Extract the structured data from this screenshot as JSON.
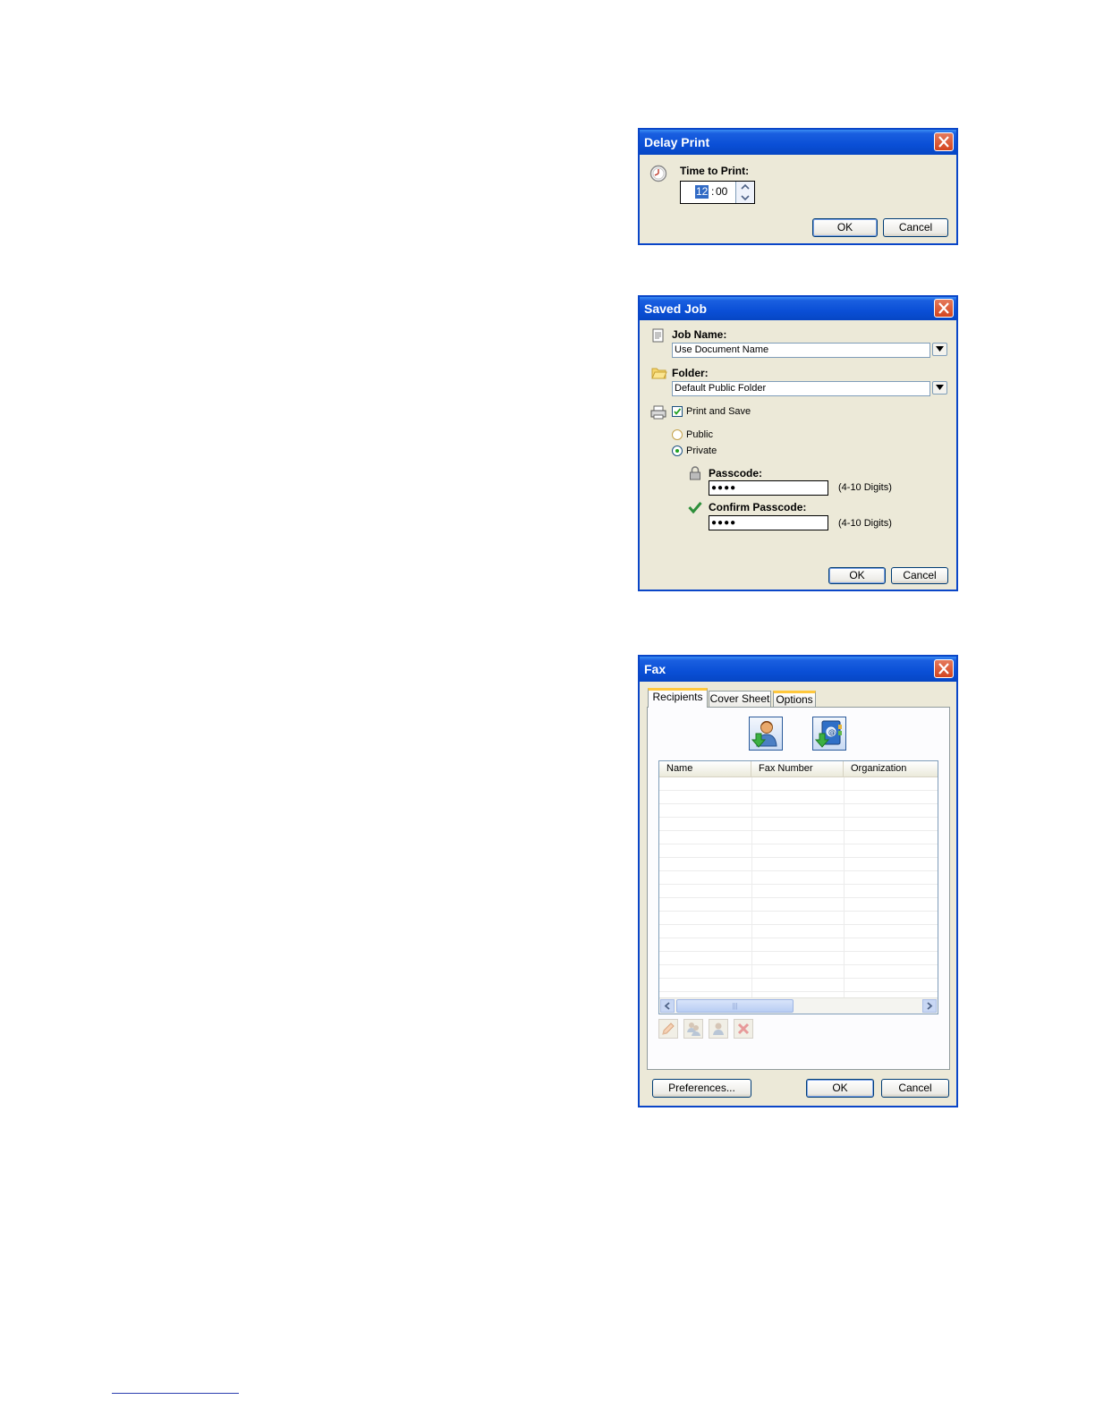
{
  "delay_print": {
    "title": "Delay Print",
    "time_label": "Time to Print:",
    "hour": "12",
    "separator": ":",
    "minute": "00",
    "ok": "OK",
    "cancel": "Cancel"
  },
  "saved_job": {
    "title": "Saved Job",
    "job_name_label": "Job Name:",
    "job_name_value": "Use Document Name",
    "folder_label": "Folder:",
    "folder_value": "Default Public Folder",
    "print_and_save": "Print and Save",
    "print_and_save_checked": true,
    "public": "Public",
    "private": "Private",
    "selected": "Private",
    "passcode_label": "Passcode:",
    "passcode_value": "●●●●",
    "passcode_hint": "(4-10 Digits)",
    "confirm_label": "Confirm Passcode:",
    "confirm_value": "●●●●",
    "confirm_hint": "(4-10 Digits)",
    "ok": "OK",
    "cancel": "Cancel"
  },
  "fax": {
    "title": "Fax",
    "tabs": [
      "Recipients",
      "Cover Sheet",
      "Options"
    ],
    "active_tab": "Recipients",
    "columns": [
      "Name",
      "Fax Number",
      "Organization"
    ],
    "scroll_grip": "|||",
    "preferences": "Preferences...",
    "ok": "OK",
    "cancel": "Cancel",
    "colors": {
      "title_bar": "#0a4fd6",
      "dialog_bg": "#ece9d8",
      "tab_highlight": "#ffc83c"
    }
  }
}
